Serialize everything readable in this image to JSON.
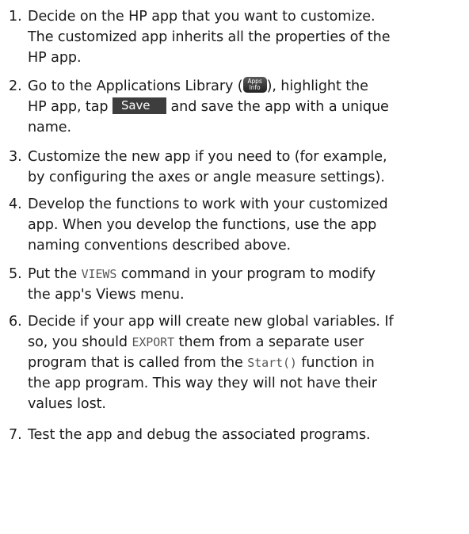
{
  "steps": [
    {
      "number": "1.",
      "lines": [
        "Decide on the HP app that you want to customize.",
        "The customized app inherits all the properties of the",
        "HP app."
      ]
    },
    {
      "number": "2.",
      "line1_before": "Go to the Applications Library (",
      "key_top": "Apps",
      "key_bottom": "Info",
      "line1_after": "), highlight the",
      "line2_before": "HP app, tap",
      "button_label": "Save",
      "line2_after": "and save the app with a unique",
      "line3": "name."
    },
    {
      "number": "3.",
      "lines": [
        "Customize the new app if you need to (for example,",
        "by configuring the axes or angle measure settings)."
      ]
    },
    {
      "number": "4.",
      "lines": [
        "Develop the functions to work with your customized",
        "app. When you develop the functions, use the app",
        "naming conventions described above."
      ]
    },
    {
      "number": "5.",
      "line1_before": "Put the",
      "code": "VIEWS",
      "line1_after": "command in your program to modify",
      "line2": "the app's Views menu."
    },
    {
      "number": "6.",
      "line1": "Decide if your app will create new global variables. If",
      "line2_before": "so, you should",
      "code_export": "EXPORT",
      "line2_after": "them from a separate user",
      "line3_before": "program that is called from the",
      "code_start": "Start()",
      "line3_after": "function in",
      "line4": "the app program. This way they will not have their",
      "line5": "values lost."
    },
    {
      "number": "7.",
      "lines": [
        "Test the app and debug the associated programs."
      ]
    }
  ]
}
